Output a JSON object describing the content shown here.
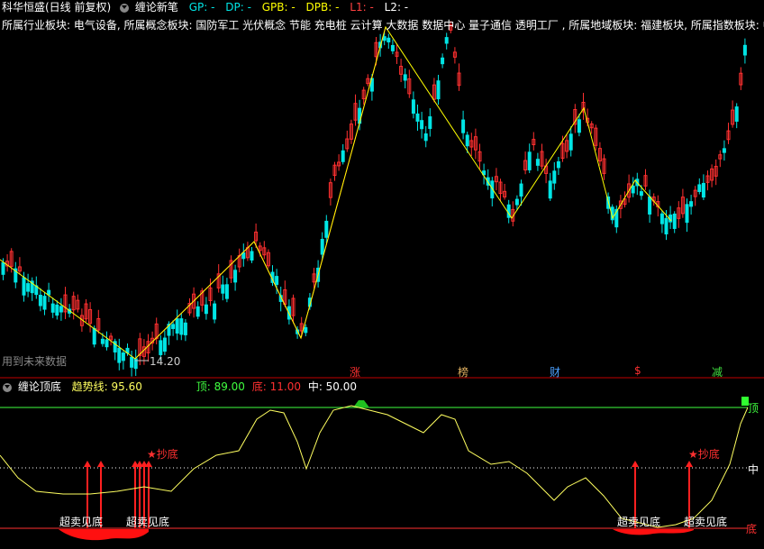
{
  "header": {
    "stock_name": "科华恒盛(日线 前复权)",
    "indicator_name": "缠论新笔",
    "indicators": [
      {
        "label": "GP: -",
        "color": "#00e5e5"
      },
      {
        "label": "DP: -",
        "color": "#00e5e5"
      },
      {
        "label": "GPB: -",
        "color": "#ffff00"
      },
      {
        "label": "DPB: -",
        "color": "#ffff00"
      },
      {
        "label": "L1: -",
        "color": "#ff4040"
      },
      {
        "label": "L2: -",
        "color": "#ffffff"
      }
    ]
  },
  "sector_line": "所属行业板块: 电气设备, 所属概念板块: 国防军工 光伏概念 节能 充电桩 云计算 大数据 数据中心 量子通信 透明工厂 , 所属地域板块: 福建板块, 所属指数板块: 中证",
  "main_chart": {
    "future_data_label": "用到未来数据",
    "low_price_label": "14.20",
    "event_markers": [
      {
        "label": "涨",
        "color": "#ff3030"
      },
      {
        "label": "榜",
        "color": "#e0b060"
      },
      {
        "label": "财",
        "color": "#4aa0ff"
      },
      {
        "label": "$",
        "color": "#ff3030"
      },
      {
        "label": "减",
        "color": "#40e040"
      }
    ],
    "colors": {
      "up": "#ff3030",
      "down": "#00e5e5",
      "pen": "#ffff00",
      "bi": "#ff3030"
    }
  },
  "sub_chart": {
    "name": "缠论顶底",
    "trend_label": "趋势线: 95.60",
    "top_label": "顶: 89.00",
    "bottom_label": "底: 11.00",
    "mid_label": "中: 50.00",
    "right_top": "顶",
    "right_mid": "中",
    "right_bottom": "底",
    "buy_signals": [
      "★抄底",
      "★抄底"
    ],
    "oversold_labels": [
      "超卖见底",
      "超卖见底",
      "超卖见底",
      "超卖见底"
    ],
    "colors": {
      "trend": "#ffff60",
      "top": "#40ff40",
      "bottom": "#ff3030",
      "mid": "#ffffff"
    }
  }
}
